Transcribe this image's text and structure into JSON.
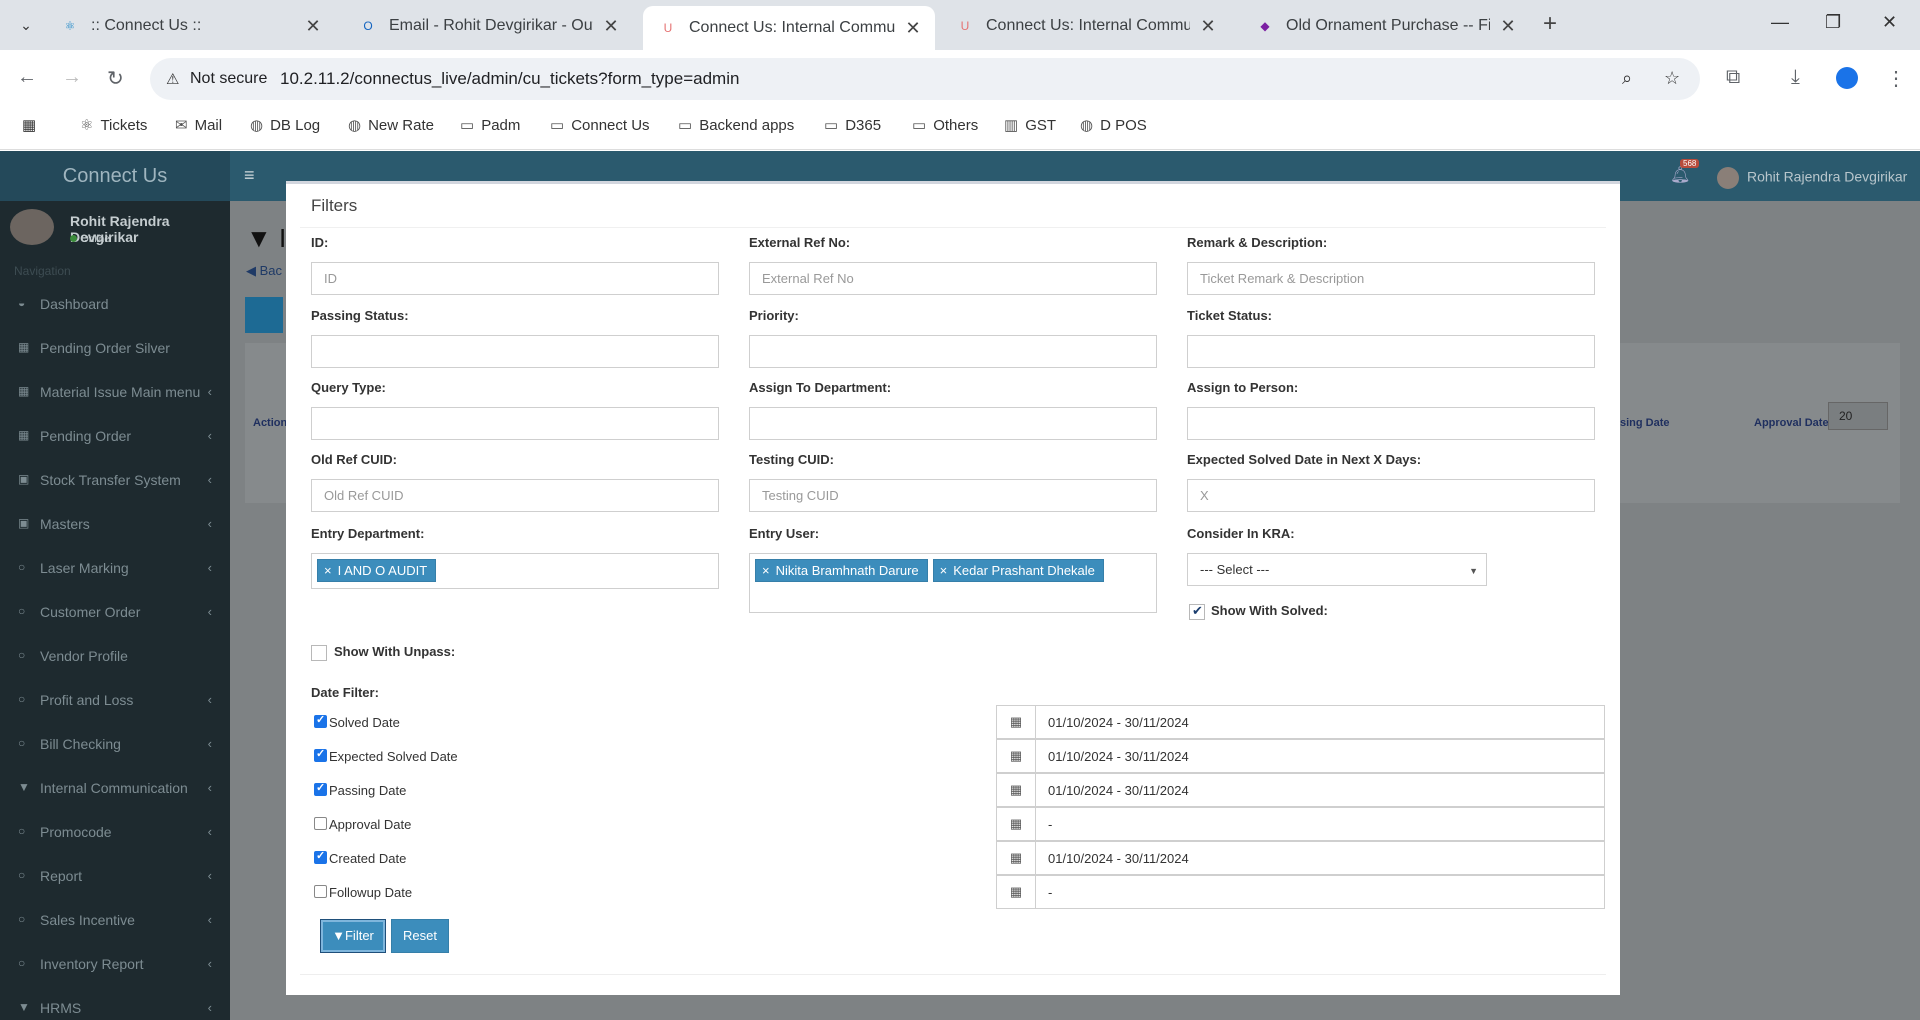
{
  "browser": {
    "tabs": [
      {
        "title": ":: Connect Us ::",
        "favicon_color": "#1e88c8",
        "favicon": "⚛"
      },
      {
        "title": "Email - Rohit Devgirikar - Outlook",
        "favicon_color": "#1565c0",
        "favicon": "O"
      },
      {
        "title": "Connect Us: Internal Communication",
        "favicon_color": "#e57373",
        "favicon": "U"
      },
      {
        "title": "Connect Us: Internal Communication",
        "favicon_color": "#e57373",
        "favicon": "U"
      },
      {
        "title": "Old Ornament Purchase -- Finance",
        "favicon_color": "#7b1fa2",
        "favicon": "◆"
      }
    ],
    "security_label": "Not secure",
    "url": "10.2.11.2/connectus_live/admin/cu_tickets?form_type=admin",
    "bookmarks": [
      "Tickets",
      "Mail",
      "DB Log",
      "New Rate",
      "Padm",
      "Connect Us",
      "Backend apps",
      "D365",
      "Others",
      "GST",
      "D POS"
    ]
  },
  "app": {
    "brand": "Connect Us",
    "notif_count": "568",
    "user_name": "Rohit Rajendra Devgirikar",
    "user_status": "Online",
    "nav_heading": "Navigation",
    "nav_items": [
      {
        "label": "Dashboard",
        "icon": "◒",
        "chev": ""
      },
      {
        "label": "Pending Order Silver",
        "icon": "▦",
        "chev": ""
      },
      {
        "label": "Material Issue Main menu",
        "icon": "▦",
        "chev": "‹"
      },
      {
        "label": "Pending Order",
        "icon": "▦",
        "chev": "‹"
      },
      {
        "label": "Stock Transfer System",
        "icon": "▣",
        "chev": "‹"
      },
      {
        "label": "Masters",
        "icon": "▣",
        "chev": "‹"
      },
      {
        "label": "Laser Marking",
        "icon": "○",
        "chev": "‹"
      },
      {
        "label": "Customer Order",
        "icon": "○",
        "chev": "‹"
      },
      {
        "label": "Vendor Profile",
        "icon": "○",
        "chev": ""
      },
      {
        "label": "Profit and Loss",
        "icon": "○",
        "chev": "‹"
      },
      {
        "label": "Bill Checking",
        "icon": "○",
        "chev": "‹"
      },
      {
        "label": "Internal Communication",
        "icon": "▼",
        "chev": "‹"
      },
      {
        "label": "Promocode",
        "icon": "○",
        "chev": "‹"
      },
      {
        "label": "Report",
        "icon": "○",
        "chev": "‹"
      },
      {
        "label": "Sales Incentive",
        "icon": "○",
        "chev": "‹"
      },
      {
        "label": "Inventory Report",
        "icon": "○",
        "chev": "‹"
      },
      {
        "label": "HRMS",
        "icon": "▼",
        "chev": "‹"
      }
    ],
    "bg_page": {
      "title_fragment": "In",
      "back_fragment": "Bac",
      "action_col": "Action",
      "col_passing": "sing Date",
      "col_approval": "Approval Date",
      "page_size": "20"
    }
  },
  "filters": {
    "title": "Filters",
    "id_label": "ID:",
    "id_placeholder": "ID",
    "extref_label": "External Ref No:",
    "extref_placeholder": "External Ref No",
    "remark_label": "Remark & Description:",
    "remark_placeholder": "Ticket Remark & Description",
    "passing_status_label": "Passing Status:",
    "priority_label": "Priority:",
    "ticket_status_label": "Ticket Status:",
    "query_type_label": "Query Type:",
    "assign_dept_label": "Assign To Department:",
    "assign_person_label": "Assign to Person:",
    "old_ref_label": "Old Ref CUID:",
    "old_ref_placeholder": "Old Ref CUID",
    "testing_label": "Testing CUID:",
    "testing_placeholder": "Testing CUID",
    "expected_label": "Expected Solved Date in Next X Days:",
    "expected_placeholder": "X",
    "entry_dept_label": "Entry Department:",
    "entry_dept_tags": [
      "I AND O AUDIT"
    ],
    "entry_user_label": "Entry User:",
    "entry_user_tags": [
      "Nikita Bramhnath Darure",
      "Kedar Prashant Dhekale"
    ],
    "kra_label": "Consider In KRA:",
    "kra_value": "--- Select ---",
    "show_solved_label": "Show With Solved:",
    "show_solved": true,
    "show_unpass_label": "Show With Unpass:",
    "show_unpass": false,
    "date_filter_label": "Date Filter:",
    "date_filters": [
      {
        "label": "Solved Date",
        "checked": true,
        "value": "01/10/2024 - 30/11/2024"
      },
      {
        "label": "Expected Solved Date",
        "checked": true,
        "value": "01/10/2024 - 30/11/2024"
      },
      {
        "label": "Passing Date",
        "checked": true,
        "value": "01/10/2024 - 30/11/2024"
      },
      {
        "label": "Approval Date",
        "checked": false,
        "value": "-"
      },
      {
        "label": "Created Date",
        "checked": true,
        "value": "01/10/2024 - 30/11/2024"
      },
      {
        "label": "Followup Date",
        "checked": false,
        "value": "-"
      }
    ],
    "filter_btn": "Filter",
    "reset_btn": "Reset"
  }
}
